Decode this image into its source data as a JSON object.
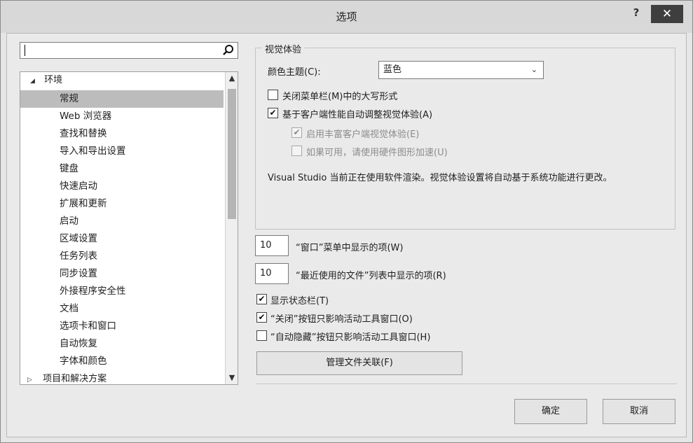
{
  "window": {
    "title": "选项",
    "help_label": "?",
    "close_label": "✕"
  },
  "search": {
    "value": "",
    "placeholder": ""
  },
  "tree": {
    "root_label": "环境",
    "items": [
      {
        "label": "常规",
        "selected": true
      },
      {
        "label": "Web 浏览器"
      },
      {
        "label": "查找和替换"
      },
      {
        "label": "导入和导出设置"
      },
      {
        "label": "键盘"
      },
      {
        "label": "快速启动"
      },
      {
        "label": "扩展和更新"
      },
      {
        "label": "启动"
      },
      {
        "label": "区域设置"
      },
      {
        "label": "任务列表"
      },
      {
        "label": "同步设置"
      },
      {
        "label": "外接程序安全性"
      },
      {
        "label": "文档"
      },
      {
        "label": "选项卡和窗口"
      },
      {
        "label": "自动恢复"
      },
      {
        "label": "字体和颜色"
      }
    ],
    "bottom_label": "项目和解决方案"
  },
  "visual": {
    "group_title": "视觉体验",
    "theme_label": "颜色主题(C):",
    "theme_value": "蓝色",
    "cb_uppercase": "关闭菜单栏(M)中的大写形式",
    "cb_auto_adjust": "基于客户端性能自动调整视觉体验(A)",
    "cb_rich": "启用丰富客户端视觉体验(E)",
    "cb_hardware": "如果可用，请使用硬件图形加速(U)",
    "info": "Visual Studio 当前正在使用软件渲染。视觉体验设置将自动基于系统功能进行更改。"
  },
  "settings": {
    "window_items_value": "10",
    "window_items_label": "“窗口”菜单中显示的项(W)",
    "recent_items_value": "10",
    "recent_items_label": "“最近使用的文件”列表中显示的项(R)",
    "cb_statusbar": "显示状态栏(T)",
    "cb_close_button": "“关闭”按钮只影响活动工具窗口(O)",
    "cb_autohide": "“自动隐藏”按钮只影响活动工具窗口(H)",
    "file_assoc_button": "管理文件关联(F)"
  },
  "footer": {
    "ok_label": "确定",
    "cancel_label": "取消"
  },
  "checkbox_states": {
    "uppercase": false,
    "auto_adjust": true,
    "rich": true,
    "hardware": false,
    "statusbar": true,
    "close_button": true,
    "autohide": false
  },
  "colors": {
    "selection": "#bcbcbc",
    "close_button": "#3e3e3e"
  }
}
